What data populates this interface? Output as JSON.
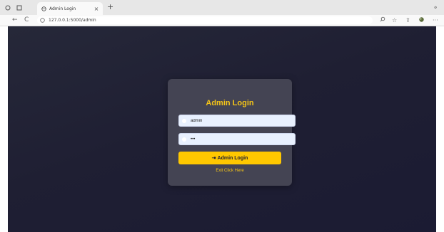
{
  "browser": {
    "tab_title": "Admin Login",
    "tab_close": "×",
    "new_tab": "+",
    "window_control": "ℴ",
    "back": "←",
    "refresh": "C",
    "address": "127.0.0.1:5000/admin",
    "icons": [
      "search-icon",
      "star-icon",
      "collections-icon",
      "extension-icon",
      "more-icon"
    ]
  },
  "login": {
    "title": "Admin Login",
    "username_value": "admin",
    "password_value": "•••",
    "button_label": "Admin Login",
    "button_icon": "⇥",
    "exit_label": "Exit Click Here"
  },
  "colors": {
    "accent": "#f5c518",
    "button": "#ffc800",
    "background": "#1f1f33",
    "card": "#484856"
  }
}
